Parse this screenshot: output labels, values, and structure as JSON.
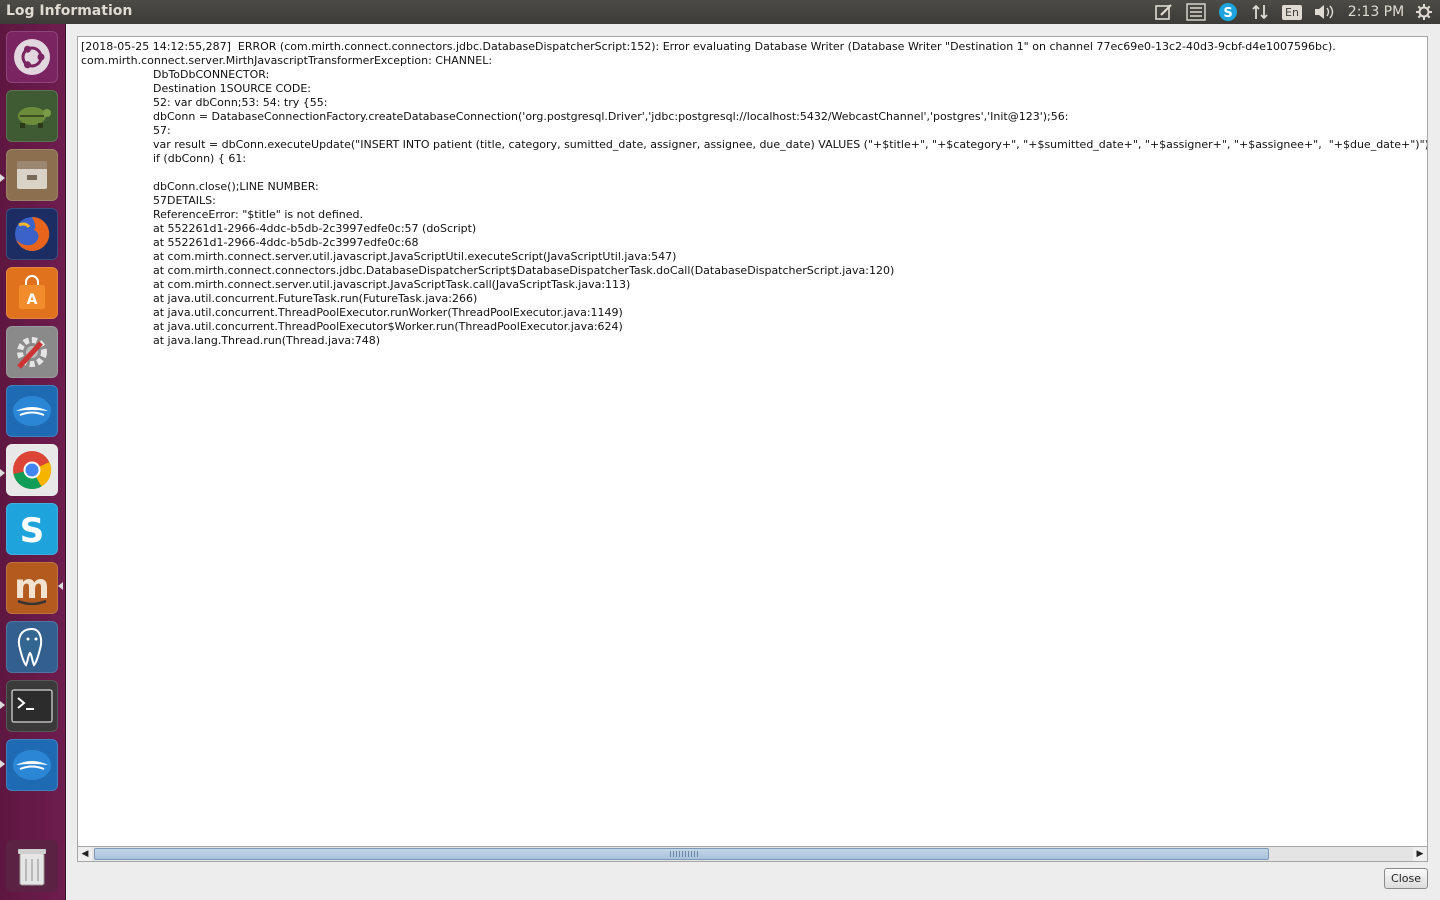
{
  "window": {
    "title": "Log Information"
  },
  "top_panel": {
    "tray_icons": [
      "note-edit-icon",
      "menu-list-icon",
      "skype-tray-icon",
      "network-arrows-icon",
      "keyboard-layout-icon",
      "volume-icon",
      "settings-gear-icon"
    ],
    "keyboard_layout": "En",
    "clock": "2:13 PM"
  },
  "launcher": {
    "items": [
      {
        "name": "ubuntu-dash-icon",
        "bg": "#7a2461"
      },
      {
        "name": "turtle-app-icon",
        "bg": "#3f5b34"
      },
      {
        "name": "files-icon",
        "bg": "#8b6f4e"
      },
      {
        "name": "firefox-icon",
        "bg": "#d44c12"
      },
      {
        "name": "software-center-icon",
        "bg": "#e0721d"
      },
      {
        "name": "system-settings-icon",
        "bg": "#7b7b7b"
      },
      {
        "name": "libreoffice-icon",
        "bg": "#1f6bb3"
      },
      {
        "name": "chrome-icon",
        "bg": "#e8e8e8"
      },
      {
        "name": "skype-icon",
        "bg": "#1fa3dc"
      },
      {
        "name": "mendeley-icon",
        "bg": "#b35a1e"
      },
      {
        "name": "pgadmin-icon",
        "bg": "#335f8f"
      },
      {
        "name": "terminal-icon",
        "bg": "#333333"
      },
      {
        "name": "openoffice-icon",
        "bg": "#1f6bb3"
      },
      {
        "name": "trash-icon",
        "bg": "#d0d0d0"
      }
    ]
  },
  "log": {
    "lines": [
      "[2018-05-25 14:12:55,287]  ERROR (com.mirth.connect.connectors.jdbc.DatabaseDispatcherScript:152): Error evaluating Database Writer (Database Writer \"Destination 1\" on channel 77ec69e0-13c2-40d3-9cbf-d4e1007596bc).",
      "com.mirth.connect.server.MirthJavascriptTransformerException: CHANNEL:",
      "\t\tDbToDbCONNECTOR:",
      "\t\tDestination 1SOURCE CODE:",
      "\t\t52: var dbConn;53: 54: try {55:",
      "\t\tdbConn = DatabaseConnectionFactory.createDatabaseConnection('org.postgresql.Driver','jdbc:postgresql://localhost:5432/WebcastChannel','postgres','Init@123');56:",
      "\t\t57:",
      "\t\tvar result = dbConn.executeUpdate(\"INSERT INTO patient (title, category, sumitted_date, assigner, assignee, due_date) VALUES (\"+$title+\", \"+$category+\", \"+$sumitted_date+\", \"+$assigner+\", \"+$assignee+\",  \"+$due_date+\")\");",
      "\t\tif (dbConn) { 61:",
      "",
      "\t\tdbConn.close();LINE NUMBER:",
      "\t\t57DETAILS:",
      "\t\tReferenceError: \"$title\" is not defined.",
      "\t\tat 552261d1-2966-4ddc-b5db-2c3997edfe0c:57 (doScript)",
      "\t\tat 552261d1-2966-4ddc-b5db-2c3997edfe0c:68",
      "\t\tat com.mirth.connect.server.util.javascript.JavaScriptUtil.executeScript(JavaScriptUtil.java:547)",
      "\t\tat com.mirth.connect.connectors.jdbc.DatabaseDispatcherScript$DatabaseDispatcherTask.doCall(DatabaseDispatcherScript.java:120)",
      "\t\tat com.mirth.connect.server.util.javascript.JavaScriptTask.call(JavaScriptTask.java:113)",
      "\t\tat java.util.concurrent.FutureTask.run(FutureTask.java:266)",
      "\t\tat java.util.concurrent.ThreadPoolExecutor.runWorker(ThreadPoolExecutor.java:1149)",
      "\t\tat java.util.concurrent.ThreadPoolExecutor$Worker.run(ThreadPoolExecutor.java:624)",
      "\t\tat java.lang.Thread.run(Thread.java:748)"
    ]
  },
  "scrollbar": {
    "position_fraction": 0.0,
    "visible_fraction": 0.88
  },
  "buttons": {
    "close_label": "Close"
  },
  "colors": {
    "launcher_bg": "#6b1a4c",
    "panel_bg": "#3c3b37",
    "accent_orange": "#e95420"
  }
}
